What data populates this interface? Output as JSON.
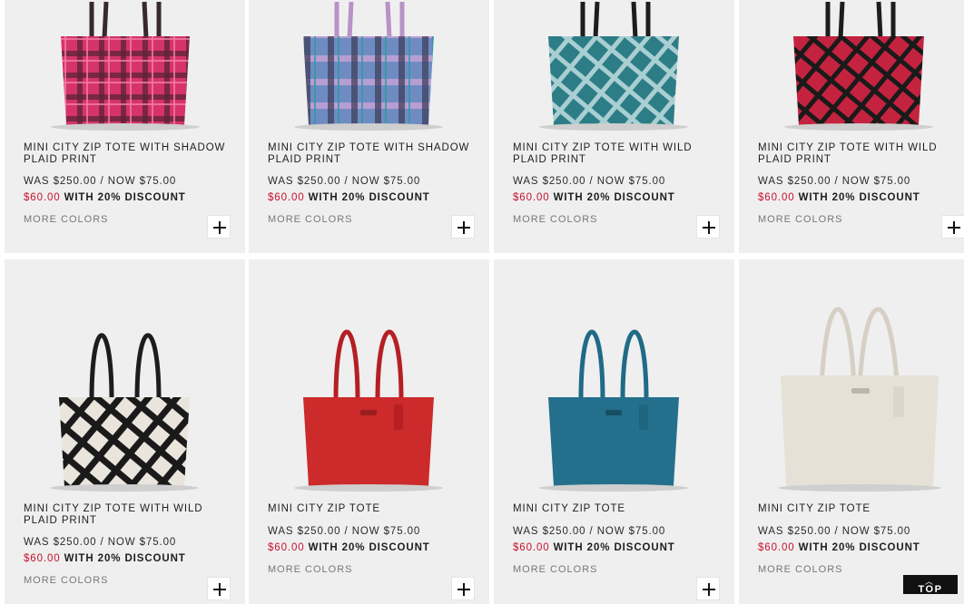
{
  "products": [
    {
      "title": "MINI CITY ZIP TOTE WITH SHADOW PLAID PRINT",
      "was_price": "WAS $250.00 / NOW $75.00",
      "sale_price": "$60.00",
      "discount_note": "WITH 20% DISCOUNT",
      "more_colors": "MORE COLORS",
      "image": "pink-plaid-tote"
    },
    {
      "title": "MINI CITY ZIP TOTE WITH SHADOW PLAID PRINT",
      "was_price": "WAS $250.00 / NOW $75.00",
      "sale_price": "$60.00",
      "discount_note": "WITH 20% DISCOUNT",
      "more_colors": "MORE COLORS",
      "image": "blue-lilac-plaid-tote"
    },
    {
      "title": "MINI CITY ZIP TOTE WITH WILD PLAID PRINT",
      "was_price": "WAS $250.00 / NOW $75.00",
      "sale_price": "$60.00",
      "discount_note": "WITH 20% DISCOUNT",
      "more_colors": "MORE COLORS",
      "image": "teal-wild-plaid-tote"
    },
    {
      "title": "MINI CITY ZIP TOTE WITH WILD PLAID PRINT",
      "was_price": "WAS $250.00 / NOW $75.00",
      "sale_price": "$60.00",
      "discount_note": "WITH 20% DISCOUNT",
      "more_colors": "MORE COLORS",
      "image": "red-wild-plaid-tote"
    },
    {
      "title": "MINI CITY ZIP TOTE WITH WILD PLAID PRINT",
      "was_price": "WAS $250.00 / NOW $75.00",
      "sale_price": "$60.00",
      "discount_note": "WITH 20% DISCOUNT",
      "more_colors": "MORE COLORS",
      "image": "black-white-wild-plaid-tote"
    },
    {
      "title": "MINI CITY ZIP TOTE",
      "was_price": "WAS $250.00 / NOW $75.00",
      "sale_price": "$60.00",
      "discount_note": "WITH 20% DISCOUNT",
      "more_colors": "MORE COLORS",
      "image": "red-leather-tote"
    },
    {
      "title": "MINI CITY ZIP TOTE",
      "was_price": "WAS $250.00 / NOW $75.00",
      "sale_price": "$60.00",
      "discount_note": "WITH 20% DISCOUNT",
      "more_colors": "MORE COLORS",
      "image": "teal-leather-tote"
    },
    {
      "title": "MINI CITY ZIP TOTE",
      "was_price": "WAS $250.00 / NOW $75.00",
      "sale_price": "$60.00",
      "discount_note": "WITH 20% DISCOUNT",
      "more_colors": "MORE COLORS",
      "image": "chalk-leather-tote"
    }
  ],
  "back_to_top": {
    "label": "TOP",
    "icon": "chevron-up-icon"
  },
  "colors": {
    "card_bg": "#efefef",
    "sale_red": "#c8102e",
    "top_button": "#111111"
  }
}
